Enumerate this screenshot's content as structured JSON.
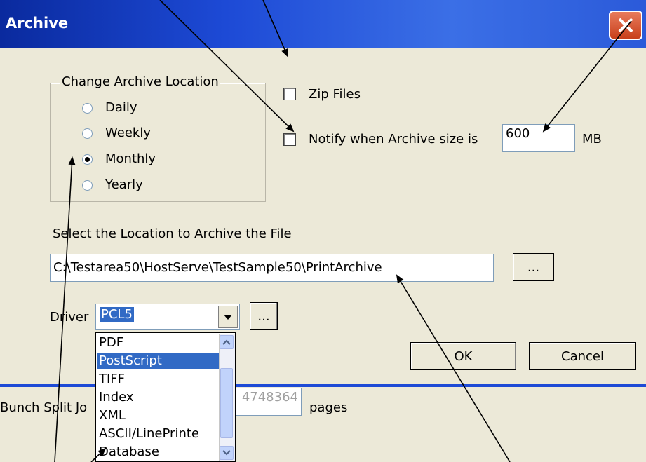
{
  "window": {
    "title": "Archive"
  },
  "location_group": {
    "title": "Change Archive Location",
    "options": [
      "Daily",
      "Weekly",
      "Monthly",
      "Yearly"
    ],
    "selected": "Monthly"
  },
  "zip_files": {
    "label": "Zip Files",
    "checked": false
  },
  "notify": {
    "label": "Notify when Archive size is",
    "value": "600",
    "unit": "MB",
    "checked": false
  },
  "location": {
    "label": "Select the Location to Archive the File",
    "path": "C:\\Testarea50\\HostServe\\TestSample50\\PrintArchive",
    "browse_label": "..."
  },
  "driver": {
    "label": "Driver",
    "value": "PCL5",
    "browse_label": "...",
    "options": [
      "PDF",
      "PostScript",
      "TIFF",
      "Index",
      "XML",
      "ASCII/LinePrinte",
      "Database"
    ],
    "highlighted": "PostScript"
  },
  "buttons": {
    "ok": "OK",
    "cancel": "Cancel"
  },
  "bunch": {
    "label": "Bunch Split Jo",
    "value": "4748364",
    "unit": "pages"
  },
  "icons": [
    "close-icon",
    "dropdown-arrow-icon",
    "scroll-up-icon",
    "scroll-down-icon"
  ]
}
